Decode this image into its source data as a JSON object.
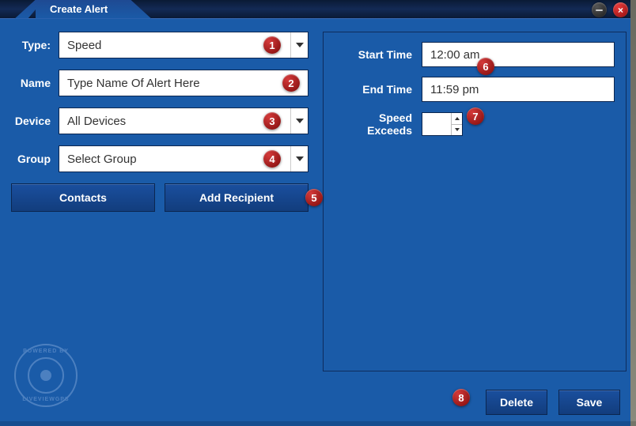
{
  "title": "Create Alert",
  "left": {
    "labels": {
      "type": "Type:",
      "name": "Name",
      "device": "Device",
      "group": "Group"
    },
    "type_value": "Speed",
    "name_placeholder": "Type Name Of Alert Here",
    "device_value": "All Devices",
    "group_value": "Select Group",
    "contacts_btn": "Contacts",
    "add_recipient_btn": "Add Recipient"
  },
  "right": {
    "labels": {
      "start": "Start Time",
      "end": "End Time",
      "speed": "Speed Exceeds"
    },
    "start_value": "12:00 am",
    "end_value": "11:59 pm",
    "speed_value": ""
  },
  "footer": {
    "delete": "Delete",
    "save": "Save"
  },
  "markers": {
    "m1": "1",
    "m2": "2",
    "m3": "3",
    "m4": "4",
    "m5": "5",
    "m6": "6",
    "m7": "7",
    "m8": "8"
  },
  "logo": {
    "top": "POWERED BY",
    "bottom": "LIVEVIEWGPS"
  }
}
